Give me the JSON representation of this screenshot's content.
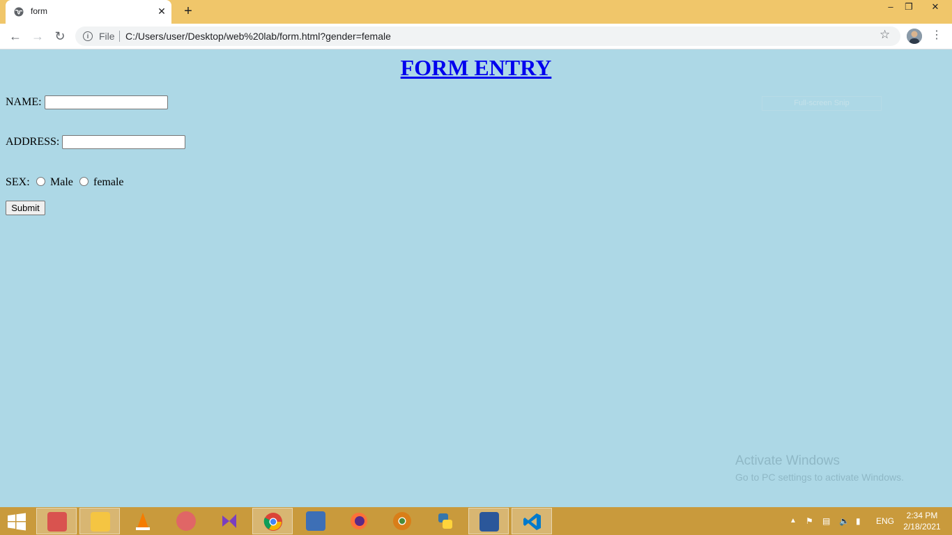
{
  "browser": {
    "tab_title": "form",
    "new_tab": "+",
    "close_tab": "✕",
    "file_label": "File",
    "url": "C:/Users/user/Desktop/web%20lab/form.html?gender=female",
    "window_controls": {
      "minimize": "–",
      "maximize": "❐",
      "close": "✕"
    },
    "nav": {
      "back": "←",
      "forward": "→",
      "reload": "↻"
    },
    "star": "☆",
    "menu": "⋮"
  },
  "page": {
    "heading": "FORM ENTRY",
    "name_label": "NAME:",
    "address_label": "ADDRESS:",
    "sex_label": "SEX:",
    "male_label": "Male",
    "female_label": "female",
    "submit_label": "Submit",
    "name_value": "",
    "address_value": ""
  },
  "overlays": {
    "snip_tooltip": "Full-screen Snip",
    "activate_title": "Activate Windows",
    "activate_subtitle": "Go to PC settings to activate Windows."
  },
  "taskbar": {
    "apps": [
      {
        "name": "snipping-tool",
        "color": "#d9534f"
      },
      {
        "name": "file-explorer",
        "color": "#f5c542"
      },
      {
        "name": "vlc",
        "color": "#f57c00"
      },
      {
        "name": "paint",
        "color": "#e06666"
      },
      {
        "name": "visual-studio",
        "color": "#7b3fbf"
      },
      {
        "name": "chrome",
        "color": "#34a853"
      },
      {
        "name": "remote-desktop",
        "color": "#3d6fb6"
      },
      {
        "name": "firefox",
        "color": "#ff7139"
      },
      {
        "name": "chrome-canary",
        "color": "#d97e18"
      },
      {
        "name": "python",
        "color": "#3776ab"
      },
      {
        "name": "word",
        "color": "#2b579a"
      },
      {
        "name": "vscode",
        "color": "#007acc"
      }
    ],
    "language": "ENG",
    "time": "2:34 PM",
    "date": "2/18/2021"
  },
  "colors": {
    "page_background": "#add8e6",
    "titlebar": "#f0c66a",
    "taskbar": "#c99a3c",
    "heading_link": "#0000ee"
  }
}
